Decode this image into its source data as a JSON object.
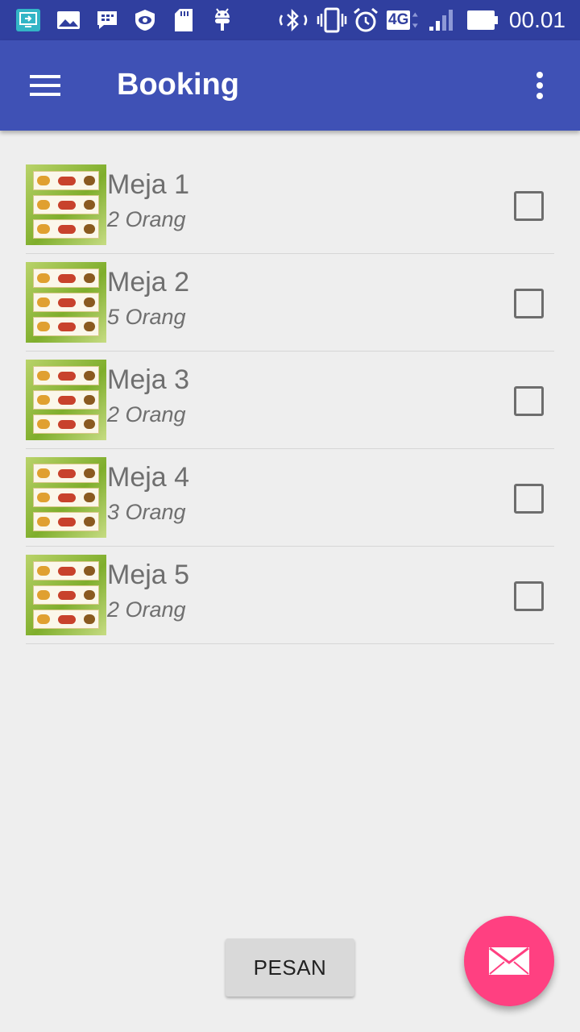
{
  "status_bar": {
    "time": "00.01",
    "network_label": "4G",
    "icons": [
      "screen-share-icon",
      "gallery-icon",
      "bbm-icon",
      "eye-shield-icon",
      "sd-card-icon",
      "android-icon",
      "bluetooth-icon",
      "vibrate-icon",
      "alarm-icon",
      "network-4g-icon",
      "signal-icon",
      "battery-icon"
    ]
  },
  "app_bar": {
    "title": "Booking",
    "nav_icon": "menu-icon",
    "overflow_icon": "more-vert-icon"
  },
  "tables": [
    {
      "name": "Meja 1",
      "capacity": "2 Orang",
      "checked": false
    },
    {
      "name": "Meja 2",
      "capacity": "5 Orang",
      "checked": false
    },
    {
      "name": "Meja 3",
      "capacity": "2 Orang",
      "checked": false
    },
    {
      "name": "Meja 4",
      "capacity": "3 Orang",
      "checked": false
    },
    {
      "name": "Meja 5",
      "capacity": "2 Orang",
      "checked": false
    }
  ],
  "actions": {
    "order_label": "PESAN",
    "fab_icon": "email-icon"
  },
  "colors": {
    "status_bar": "#303f9f",
    "app_bar": "#3f51b5",
    "fab": "#ff4081",
    "background": "#eeeeee",
    "text": "#6f6f6f"
  }
}
